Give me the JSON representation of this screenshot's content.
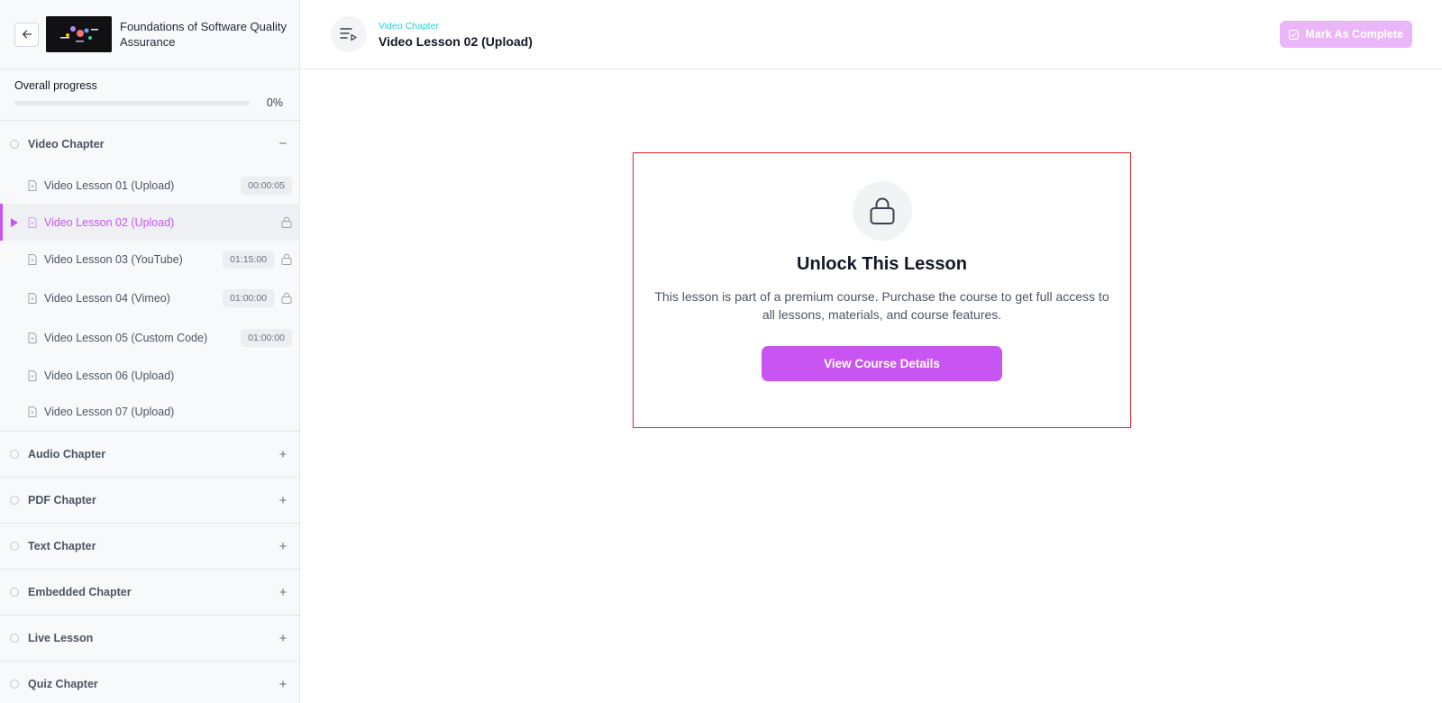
{
  "course": {
    "title": "Foundations of Software Quality Assurance"
  },
  "progress": {
    "label": "Overall progress",
    "percent_text": "0%",
    "value": 0
  },
  "chapters": {
    "video": {
      "title": "Video Chapter",
      "toggle": "−",
      "lessons": [
        {
          "title": "Video Lesson 01 (Upload)",
          "duration": "00:00:05"
        },
        {
          "title": "Video Lesson 02 (Upload)"
        },
        {
          "title": "Video Lesson 03 (YouTube)",
          "duration": "01:15:00"
        },
        {
          "title": "Video Lesson 04 (Vimeo)",
          "duration": "01:00:00"
        },
        {
          "title": "Video Lesson 05 (Custom Code)",
          "duration": "01:00:00"
        },
        {
          "title": "Video Lesson 06 (Upload)"
        },
        {
          "title": "Video Lesson 07 (Upload)"
        }
      ]
    },
    "collapsed": [
      {
        "title": "Audio Chapter",
        "toggle": "+"
      },
      {
        "title": "PDF Chapter",
        "toggle": "+"
      },
      {
        "title": "Text Chapter",
        "toggle": "+"
      },
      {
        "title": "Embedded Chapter",
        "toggle": "+"
      },
      {
        "title": "Live Lesson",
        "toggle": "+"
      },
      {
        "title": "Quiz Chapter",
        "toggle": "+"
      }
    ]
  },
  "header": {
    "chapter": "Video Chapter",
    "title": "Video Lesson 02 (Upload)",
    "complete_label": "Mark As Complete"
  },
  "unlock": {
    "title": "Unlock This Lesson",
    "text": "This lesson is part of a premium course. Purchase the course to get full access to all lessons, materials, and course features.",
    "button_label": "View Course Details"
  },
  "colors": {
    "accent": "#c855f2",
    "accent_light": "#eab6f7",
    "chapter_label": "#22d3d3",
    "highlight_border": "#e8222a"
  },
  "icons": [
    "back-arrow-icon",
    "playlist-icon",
    "file-icon",
    "lock-icon",
    "check-square-icon",
    "play-icon"
  ]
}
